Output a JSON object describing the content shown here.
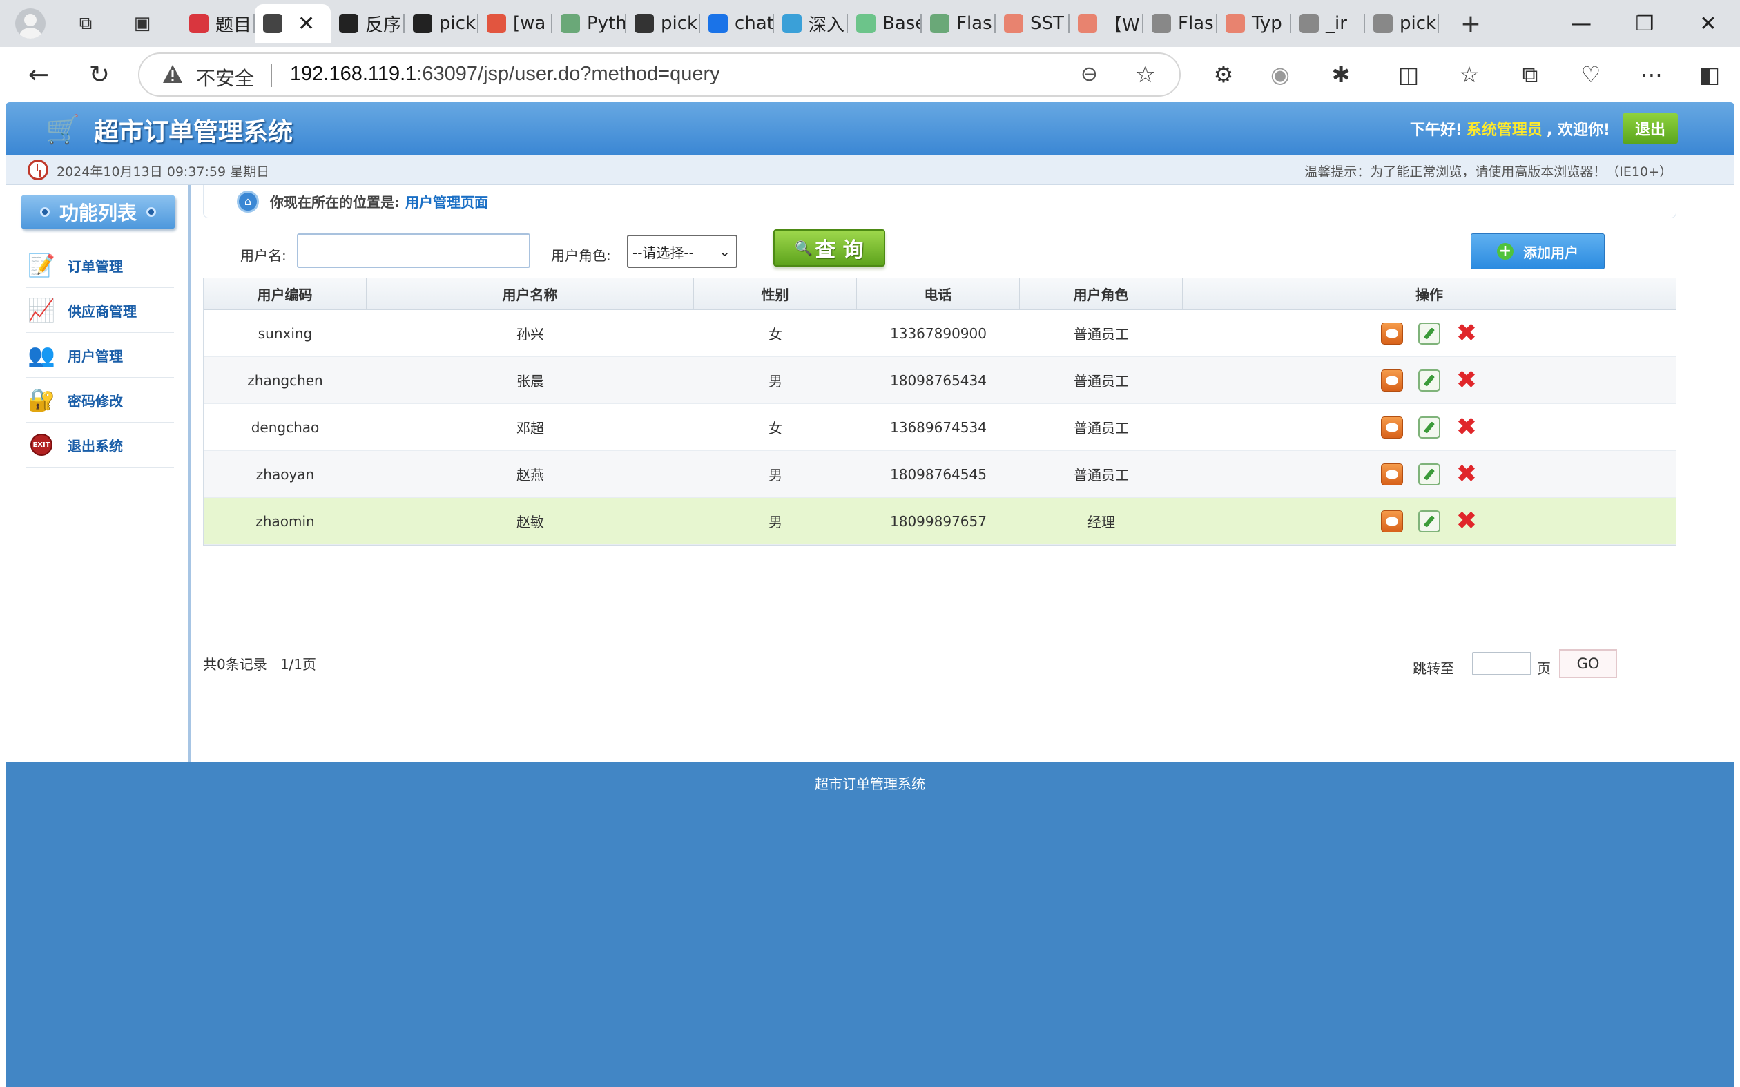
{
  "browser": {
    "tabs": [
      {
        "label": "题目",
        "favicon": "bug-icon",
        "color": "#d9363e"
      },
      {
        "label": "",
        "favicon": "document-icon",
        "color": "#444444",
        "active": true
      },
      {
        "label": "反序",
        "favicon": "search-icon",
        "color": "#222222"
      },
      {
        "label": "pick",
        "favicon": "search-icon",
        "color": "#222222"
      },
      {
        "label": "[wa",
        "favicon": "c-icon",
        "color": "#e2553f"
      },
      {
        "label": "Pyth",
        "favicon": "bars-icon",
        "color": "#6aa878"
      },
      {
        "label": "pick",
        "favicon": "slash-icon",
        "color": "#333333"
      },
      {
        "label": "chat",
        "favicon": "chat-icon",
        "color": "#1a73e8"
      },
      {
        "label": "深入",
        "favicon": "hexagon-icon",
        "color": "#3aa0d8"
      },
      {
        "label": "Base",
        "favicon": "t-icon",
        "color": "#6cc48a"
      },
      {
        "label": "Flas",
        "favicon": "bars-icon",
        "color": "#6aa878"
      },
      {
        "label": "SST",
        "favicon": "c-icon",
        "color": "#e8836f"
      },
      {
        "label": "【W",
        "favicon": "c-icon",
        "color": "#e8836f"
      },
      {
        "label": "Flas",
        "favicon": "flask-icon",
        "color": "#888888"
      },
      {
        "label": "Typ",
        "favicon": "c-icon",
        "color": "#e8836f"
      },
      {
        "label": "_ir",
        "favicon": "search-icon",
        "color": "#888888"
      },
      {
        "label": "pick",
        "favicon": "slash-icon",
        "color": "#888888"
      }
    ],
    "close_glyph": "✕",
    "new_tab_glyph": "+",
    "address": {
      "insecure_label": "不安全",
      "host": "192.168.119.1",
      "path": ":63097/jsp/user.do?method=query"
    }
  },
  "header": {
    "title": "超市订单管理系统",
    "greeting_prefix": "下午好!",
    "user": "系统管理员",
    "greeting_suffix": ", 欢迎你!",
    "logout": "退出"
  },
  "infobar": {
    "datetime": "2024年10月13日 09:37:59 星期日",
    "tip": "温馨提示：为了能正常浏览，请使用高版本浏览器！（IE10+）"
  },
  "sidebar": {
    "title": "功能列表",
    "items": [
      {
        "label": "订单管理",
        "icon": "order-icon"
      },
      {
        "label": "供应商管理",
        "icon": "supplier-icon"
      },
      {
        "label": "用户管理",
        "icon": "users-icon"
      },
      {
        "label": "密码修改",
        "icon": "password-icon"
      },
      {
        "label": "退出系统",
        "icon": "exit-icon"
      }
    ]
  },
  "location": {
    "label": "你现在所在的位置是:",
    "page": "用户管理页面"
  },
  "search": {
    "username_label": "用户名:",
    "username_value": "",
    "role_label": "用户角色:",
    "role_selected": "--请选择--",
    "query_button": "查 询",
    "add_button": "添加用户"
  },
  "table": {
    "headers": [
      "用户编码",
      "用户名称",
      "性别",
      "电话",
      "用户角色",
      "操作"
    ],
    "rows": [
      {
        "code": "sunxing",
        "name": "孙兴",
        "gender": "女",
        "phone": "13367890900",
        "role": "普通员工"
      },
      {
        "code": "zhangchen",
        "name": "张晨",
        "gender": "男",
        "phone": "18098765434",
        "role": "普通员工"
      },
      {
        "code": "dengchao",
        "name": "邓超",
        "gender": "女",
        "phone": "13689674534",
        "role": "普通员工"
      },
      {
        "code": "zhaoyan",
        "name": "赵燕",
        "gender": "男",
        "phone": "18098764545",
        "role": "普通员工"
      },
      {
        "code": "zhaomin",
        "name": "赵敏",
        "gender": "男",
        "phone": "18099897657",
        "role": "经理"
      }
    ]
  },
  "pager": {
    "count_text": "共0条记录",
    "page_text": "1/1页",
    "jump_label": "跳转至",
    "page_unit": "页",
    "go_button": "GO"
  },
  "footer": {
    "text": "超市订单管理系统"
  },
  "colors": {
    "header_blue": "#3b87d4",
    "footer_blue": "#4286c5",
    "user_highlight": "#ffea29",
    "query_green": "#5da31c",
    "highlight_row": "#e7f6d0"
  }
}
